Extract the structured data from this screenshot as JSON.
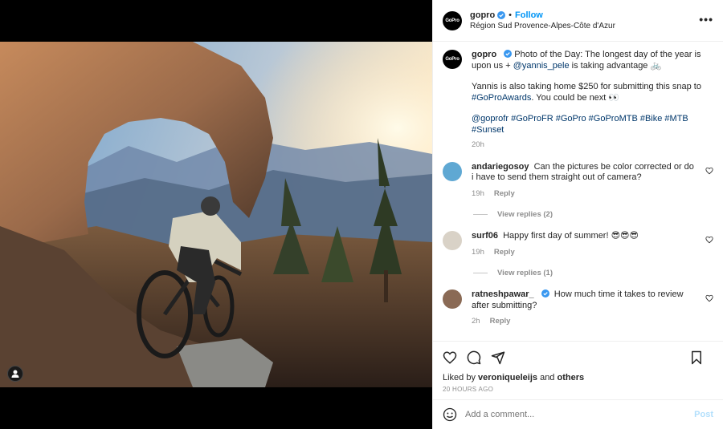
{
  "post": {
    "username": "gopro",
    "follow_label": "Follow",
    "dot": "•",
    "location": "Région Sud Provence-Alpes-Côte d'Azur",
    "more_label": "•••",
    "avatar_text": "GoPro"
  },
  "caption": {
    "username": "gopro",
    "line1": "Photo of the Day: The longest day of the year is upon us + ",
    "mention": "@yannis_pele",
    "line1_tail": " is taking advantage 🚲",
    "line2": "Yannis is also taking home $250 for submitting this snap to ",
    "hashtag_awards": "#GoProAwards",
    "line2_tail": ". You could be next 👀",
    "hashtags": "@goprofr #GoProFR #GoPro #GoProMTB #Bike #MTB #Sunset",
    "age": "20h"
  },
  "comments": [
    {
      "username": "andariegosoy",
      "text": "Can the pictures be color corrected or do i have to send them straight out of camera?",
      "age": "19h",
      "reply_label": "Reply",
      "view_replies": "View replies (2)",
      "avatar_color": "#5fa8d3"
    },
    {
      "username": "surf06",
      "text": "Happy first day of summer! 😎😎😎",
      "age": "19h",
      "reply_label": "Reply",
      "view_replies": "View replies (1)",
      "avatar_color": "#d9d2c7"
    },
    {
      "username": "ratneshpawar_",
      "text": "How much time it takes to review after submitting?",
      "age": "2h",
      "reply_label": "Reply",
      "avatar_color": "#8a6a55"
    }
  ],
  "likes": {
    "prefix": "Liked by ",
    "user": "veroniqueleijs",
    "middle": " and ",
    "others": "others",
    "time": "20 HOURS AGO"
  },
  "composer": {
    "placeholder": "Add a comment...",
    "post_label": "Post"
  },
  "colors": {
    "accent": "#0095f6",
    "verified": "#3897f0",
    "link": "#00376b"
  }
}
